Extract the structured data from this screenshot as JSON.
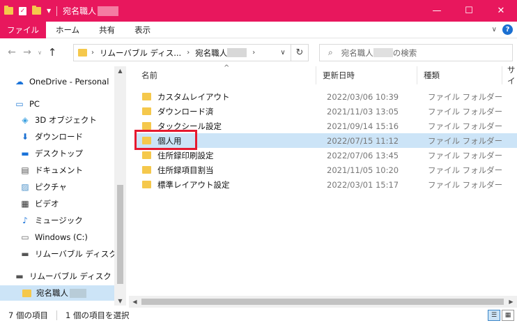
{
  "titlebar": {
    "title": "宛名職人",
    "minimize": "—",
    "maximize": "☐",
    "close": "✕",
    "accent": "#e8175d"
  },
  "ribbon": {
    "tabs": [
      "ファイル",
      "ホーム",
      "共有",
      "表示"
    ],
    "help": "?"
  },
  "address": {
    "crumbs": [
      "リムーバブル ディス...",
      "宛名職人"
    ],
    "search_placeholder_prefix": "宛名職人",
    "search_placeholder_suffix": "の検索"
  },
  "navpane": {
    "items": [
      {
        "label": "OneDrive - Personal",
        "icon": "cloud-icon"
      },
      {
        "label": "PC",
        "icon": "pc-icon"
      },
      {
        "label": "3D オブジェクト",
        "icon": "cube-icon"
      },
      {
        "label": "ダウンロード",
        "icon": "download-icon"
      },
      {
        "label": "デスクトップ",
        "icon": "desktop-icon"
      },
      {
        "label": "ドキュメント",
        "icon": "document-icon"
      },
      {
        "label": "ピクチャ",
        "icon": "picture-icon"
      },
      {
        "label": "ビデオ",
        "icon": "video-icon"
      },
      {
        "label": "ミュージック",
        "icon": "music-icon"
      },
      {
        "label": "Windows (C:)",
        "icon": "drive-icon"
      },
      {
        "label": "リムーバブル ディスク (D:)",
        "icon": "usb-drive-icon"
      },
      {
        "label": "リムーバブル ディスク (D:)",
        "icon": "usb-drive-icon"
      },
      {
        "label": "宛名職人",
        "icon": "folder-icon"
      }
    ]
  },
  "filelist": {
    "columns": [
      "名前",
      "更新日時",
      "種類",
      "サイ"
    ],
    "rows": [
      {
        "name": "カスタムレイアウト",
        "date": "2022/03/06 10:39",
        "type": "ファイル フォルダー"
      },
      {
        "name": "ダウンロード済",
        "date": "2021/11/03 13:05",
        "type": "ファイル フォルダー"
      },
      {
        "name": "タックシール設定",
        "date": "2021/09/14 15:16",
        "type": "ファイル フォルダー"
      },
      {
        "name": "個人用",
        "date": "2022/07/15 11:12",
        "type": "ファイル フォルダー"
      },
      {
        "name": "住所録印刷設定",
        "date": "2022/07/06 13:45",
        "type": "ファイル フォルダー"
      },
      {
        "name": "住所録項目割当",
        "date": "2021/11/05 10:20",
        "type": "ファイル フォルダー"
      },
      {
        "name": "標準レイアウト設定",
        "date": "2022/03/01 15:17",
        "type": "ファイル フォルダー"
      }
    ]
  },
  "status": {
    "count": "7 個の項目",
    "selected": "1 個の項目を選択"
  }
}
